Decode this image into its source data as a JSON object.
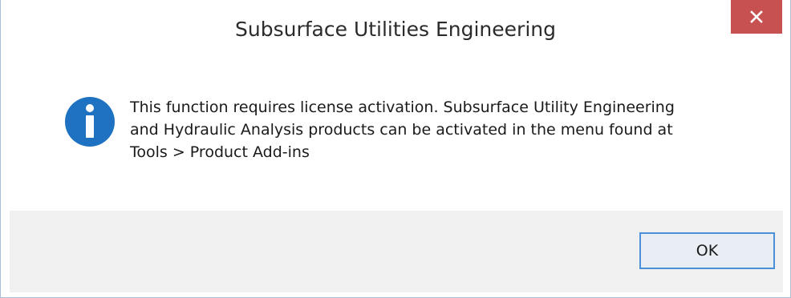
{
  "window": {
    "title": "Subsurface Utilities Engineering",
    "close_icon": "close-icon"
  },
  "dialog": {
    "icon": "info-icon",
    "message_lines": [
      "This function requires license activation.  Subsurface Utility Engineering",
      "and Hydraulic Analysis products can be activated in the menu found at",
      "Tools > Product Add-ins"
    ],
    "ok_label": "OK"
  },
  "colors": {
    "close_button": "#c75050",
    "info_icon": "#1f72c2",
    "footer_bg": "#f0f0f0",
    "ok_border": "#4a90d9"
  }
}
